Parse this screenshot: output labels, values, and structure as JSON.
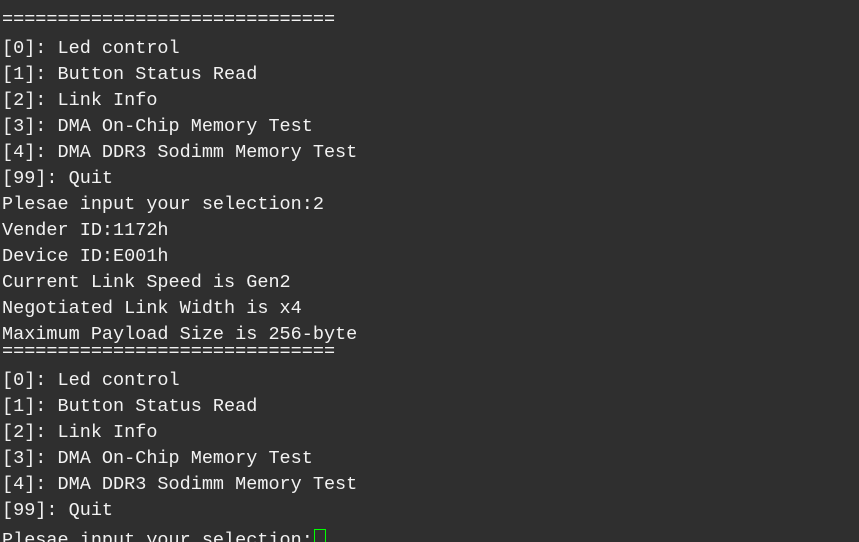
{
  "terminal": {
    "lines": [
      "==============================",
      "[0]: Led control",
      "[1]: Button Status Read",
      "[2]: Link Info",
      "[3]: DMA On-Chip Memory Test",
      "[4]: DMA DDR3 Sodimm Memory Test",
      "[99]: Quit",
      "Plesae input your selection:2",
      "Vender ID:1172h",
      "Device ID:E001h",
      "Current Link Speed is Gen2",
      "Negotiated Link Width is x4",
      "Maximum Payload Size is 256-byte",
      "==============================",
      "[0]: Led control",
      "[1]: Button Status Read",
      "[2]: Link Info",
      "[3]: DMA On-Chip Memory Test",
      "[4]: DMA DDR3 Sodimm Memory Test",
      "[99]: Quit"
    ],
    "prompt": "Plesae input your selection:",
    "colors": {
      "background": "#2f2f2f",
      "text": "#f2f2f2",
      "cursor": "#00ff00"
    }
  }
}
